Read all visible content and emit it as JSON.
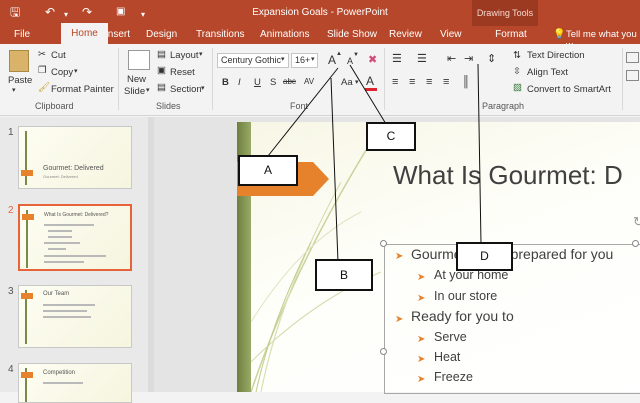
{
  "window": {
    "title": "Expansion Goals - PowerPoint",
    "drawing_tools": "Drawing Tools"
  },
  "tabs": [
    "File",
    "Home",
    "Insert",
    "Design",
    "Transitions",
    "Animations",
    "Slide Show",
    "Review",
    "View",
    "Format"
  ],
  "tell_me": "Tell me what you w",
  "ribbon": {
    "clipboard": {
      "paste": "Paste",
      "cut": "Cut",
      "copy": "Copy",
      "format_painter": "Format Painter",
      "group": "Clipboard"
    },
    "slides": {
      "new_slide": "New",
      "new_slide2": "Slide",
      "layout": "Layout",
      "reset": "Reset",
      "section": "Section",
      "group": "Slides"
    },
    "font": {
      "font_name": "Century Gothic",
      "font_size": "16+",
      "group": "Font",
      "bold": "B",
      "italic": "I",
      "underline": "U",
      "shadow": "S",
      "strike": "abc",
      "spacing": "AV",
      "case": "Aa",
      "grow": "A",
      "shrink": "A",
      "color": "A"
    },
    "paragraph": {
      "group": "Paragraph",
      "text_direction": "Text Direction",
      "align_text": "Align Text",
      "convert_smartart": "Convert to SmartArt"
    }
  },
  "thumbnails": [
    {
      "num": "1",
      "title": "Gourmet: Delivered",
      "sub": "Gourmet: Delivered"
    },
    {
      "num": "2",
      "title": "What Is Gourmet: Delivered?"
    },
    {
      "num": "3",
      "title": "Our Team"
    },
    {
      "num": "4",
      "title": "Competition"
    }
  ],
  "slide": {
    "title": "What Is Gourmet: D",
    "bullets": [
      {
        "text": "Gourmet meals prepared for you",
        "level": 1
      },
      {
        "text": "At your home",
        "level": 2
      },
      {
        "text": "In our store",
        "level": 2
      },
      {
        "text": "Ready for you to",
        "level": 1
      },
      {
        "text": "Serve",
        "level": 2
      },
      {
        "text": "Heat",
        "level": 2
      },
      {
        "text": "Freeze",
        "level": 2
      }
    ]
  },
  "callouts": {
    "a": "A",
    "b": "B",
    "c": "C",
    "d": "D"
  },
  "colors": {
    "brand": "#b7472a",
    "accent": "#e7822c",
    "selected_thumb": "#e7633a"
  }
}
